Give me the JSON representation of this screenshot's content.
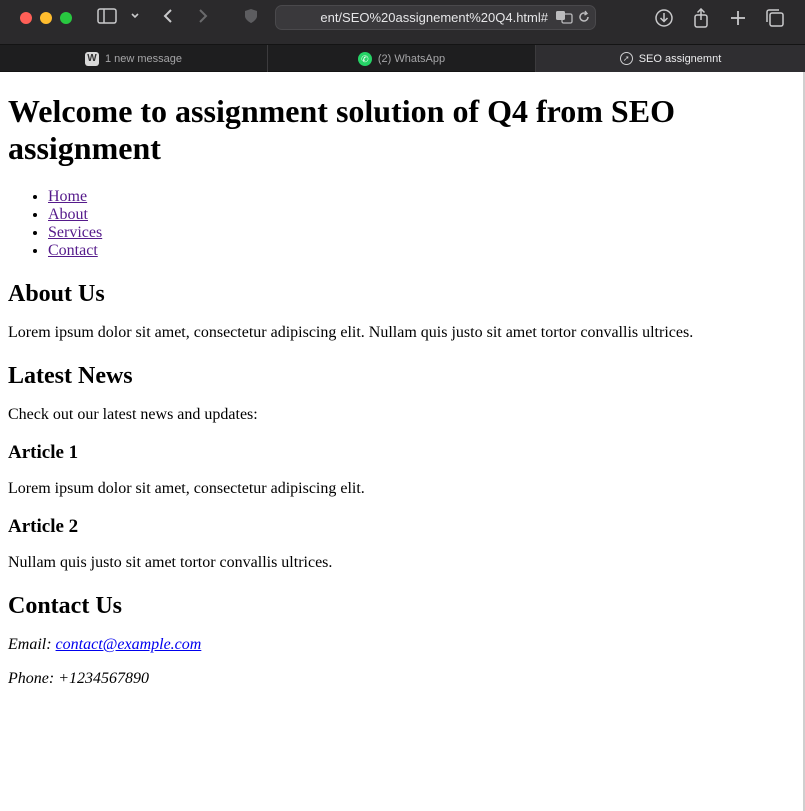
{
  "browser": {
    "address": "ent/SEO%20assignement%20Q4.html#",
    "tabs": [
      {
        "label": "1 new message",
        "icon": "wordpress-icon"
      },
      {
        "label": "(2) WhatsApp",
        "icon": "whatsapp-icon"
      },
      {
        "label": "SEO assignemnt",
        "icon": "compass-icon"
      }
    ]
  },
  "page": {
    "title": "Welcome to assignment solution of Q4 from SEO assignment",
    "nav": [
      "Home",
      "About",
      "Services",
      "Contact"
    ],
    "about": {
      "heading": "About Us",
      "text": "Lorem ipsum dolor sit amet, consectetur adipiscing elit. Nullam quis justo sit amet tortor convallis ultrices."
    },
    "news": {
      "heading": "Latest News",
      "intro": "Check out our latest news and updates:",
      "articles": [
        {
          "title": "Article 1",
          "text": "Lorem ipsum dolor sit amet, consectetur adipiscing elit."
        },
        {
          "title": "Article 2",
          "text": "Nullam quis justo sit amet tortor convallis ultrices."
        }
      ]
    },
    "contact": {
      "heading": "Contact Us",
      "email_label": "Email:",
      "email": "contact@example.com",
      "phone": "Phone: +1234567890"
    }
  }
}
